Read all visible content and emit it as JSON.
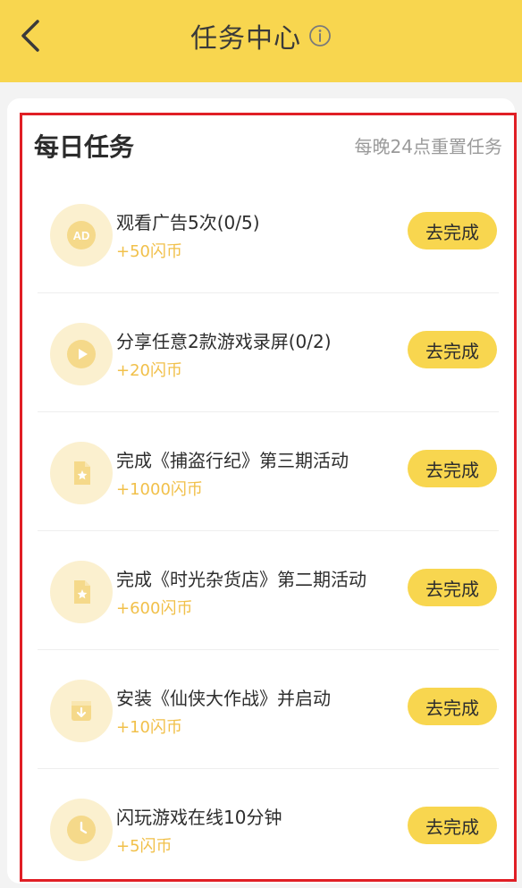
{
  "header": {
    "title": "任务中心",
    "back_icon": "back-chevron-icon",
    "info_icon": "info-icon"
  },
  "section": {
    "title": "每日任务",
    "note": "每晚24点重置任务"
  },
  "tasks": [
    {
      "name": "观看广告5次(0/5)",
      "reward": "+50闪币",
      "button": "去完成",
      "icon": "ad-icon",
      "icon_text": "AD"
    },
    {
      "name": "分享任意2款游戏录屏(0/2)",
      "reward": "+20闪币",
      "button": "去完成",
      "icon": "play-icon"
    },
    {
      "name": "完成《捕盗行纪》第三期活动",
      "reward": "+1000闪币",
      "button": "去完成",
      "icon": "document-star-icon"
    },
    {
      "name": "完成《时光杂货店》第二期活动",
      "reward": "+600闪币",
      "button": "去完成",
      "icon": "document-star-icon"
    },
    {
      "name": "安装《仙侠大作战》并启动",
      "reward": "+10闪币",
      "button": "去完成",
      "icon": "download-box-icon"
    },
    {
      "name": "闪玩游戏在线10分钟",
      "reward": "+5闪币",
      "button": "去完成",
      "icon": "clock-icon"
    }
  ],
  "colors": {
    "header_bg": "#f8d64f",
    "button_bg": "#f8d64f",
    "reward_text": "#f1c04a",
    "highlight_border": "#e01f25"
  }
}
